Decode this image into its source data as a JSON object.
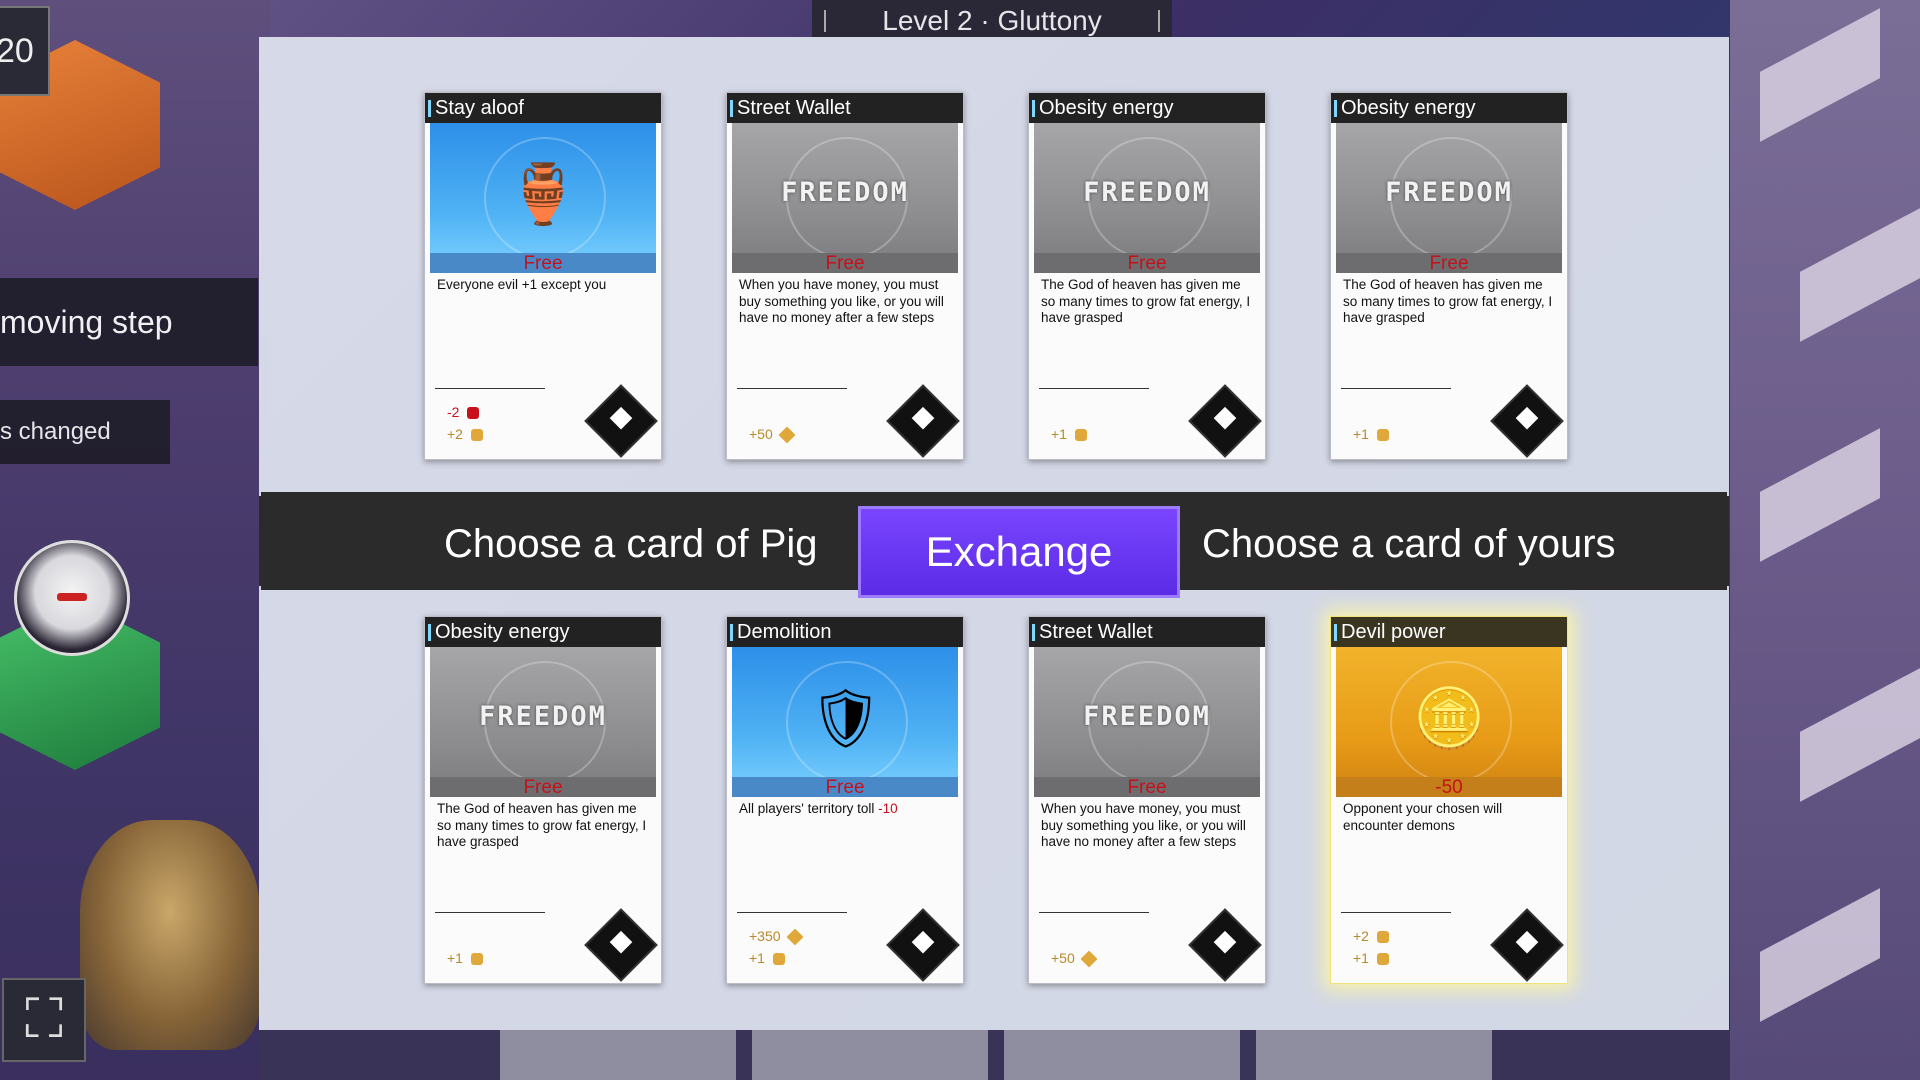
{
  "header": {
    "level_title": "Level 2 · Gluttony"
  },
  "hud": {
    "counter": "20",
    "moving_step": "moving step",
    "changed": "s changed"
  },
  "exchange": {
    "left_label": "Choose a card of Pig",
    "button_label": "Exchange",
    "right_label": "Choose a card of yours"
  },
  "opponent_cards": [
    {
      "title": "Stay aloof",
      "art": "gold-ship-icon",
      "art_style": "blue",
      "price": "Free",
      "desc": "Everyone evil +1 except you",
      "stats": [
        "-2",
        "+2"
      ]
    },
    {
      "title": "Street Wallet",
      "art": "FREEDOM",
      "art_style": "grey",
      "price": "Free",
      "desc": "When you have money, you must buy something you like, or you will have no money after a few steps",
      "stats": [
        "+50"
      ]
    },
    {
      "title": "Obesity energy",
      "art": "FREEDOM",
      "art_style": "grey",
      "price": "Free",
      "desc": "The God of heaven has given me so many times to grow fat energy, I have grasped",
      "stats": [
        "+1"
      ]
    },
    {
      "title": "Obesity energy",
      "art": "FREEDOM",
      "art_style": "grey",
      "price": "Free",
      "desc": "The God of heaven has given me so many times to grow fat energy, I have grasped",
      "stats": [
        "+1"
      ]
    }
  ],
  "player_cards": [
    {
      "title": "Obesity energy",
      "art": "FREEDOM",
      "art_style": "grey",
      "price": "Free",
      "desc": "The God of heaven has given me so many times to grow fat energy, I have grasped",
      "stats": [
        "+1"
      ]
    },
    {
      "title": "Demolition",
      "art": "shield-emblem-icon",
      "art_style": "blue",
      "price": "Free",
      "desc_main": "All players' territory toll ",
      "desc_neg": "-10",
      "stats": [
        "+350",
        "+1"
      ]
    },
    {
      "title": "Street Wallet",
      "art": "FREEDOM",
      "art_style": "grey",
      "price": "Free",
      "desc": "When you have money, you must buy something you like, or you will have no money after a few steps",
      "stats": [
        "+50"
      ]
    },
    {
      "title": "Devil power",
      "art": "gold-coin-pile-icon",
      "art_style": "gold",
      "price": "-50",
      "desc": "Opponent your chosen will encounter demons",
      "stats": [
        "+2",
        "+1"
      ],
      "selected": true
    }
  ],
  "colors": {
    "accent_purple": "#6a38f2",
    "price_red": "#c8101a",
    "stat_gold": "#b98a2a"
  }
}
